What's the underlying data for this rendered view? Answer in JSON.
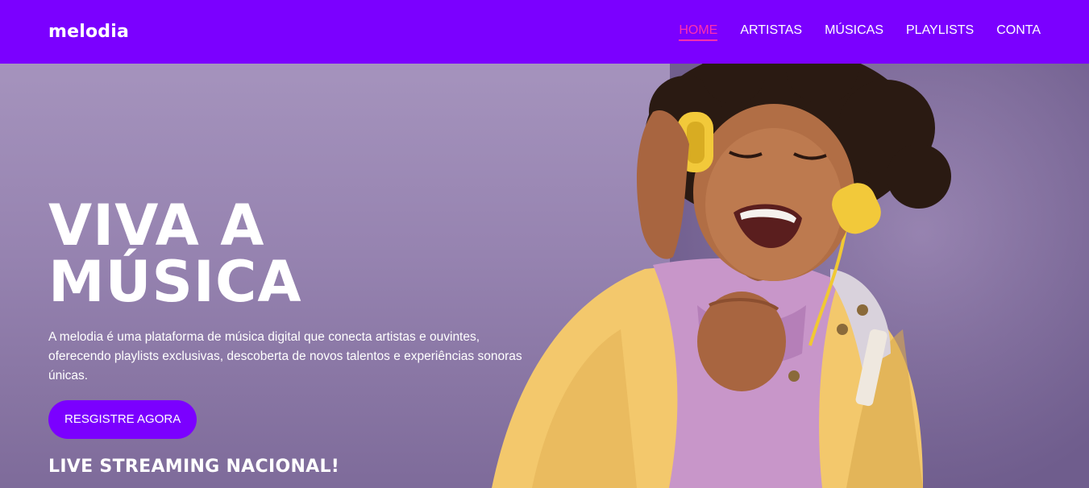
{
  "navbar": {
    "logo": "melodia",
    "links": [
      "HOME",
      "ARTISTAS",
      "MÚSICAS",
      "PLAYLISTS",
      "CONTA"
    ],
    "active_link": "HOME"
  },
  "hero": {
    "title": "VIVA A MÚSICA",
    "description": "A melodia é uma plataforma de música digital que conecta artistas e ouvintes, oferecendo playlists exclusivas, descoberta de novos talentos e experiências sonoras únicas.",
    "cta_label": "RESGISTRE AGORA",
    "tagline": "LIVE STREAMING NACIONAL!"
  },
  "colors": {
    "brand": "#7b00ff",
    "active_link": "#ff2fae",
    "hero_background": "#9683b0"
  }
}
